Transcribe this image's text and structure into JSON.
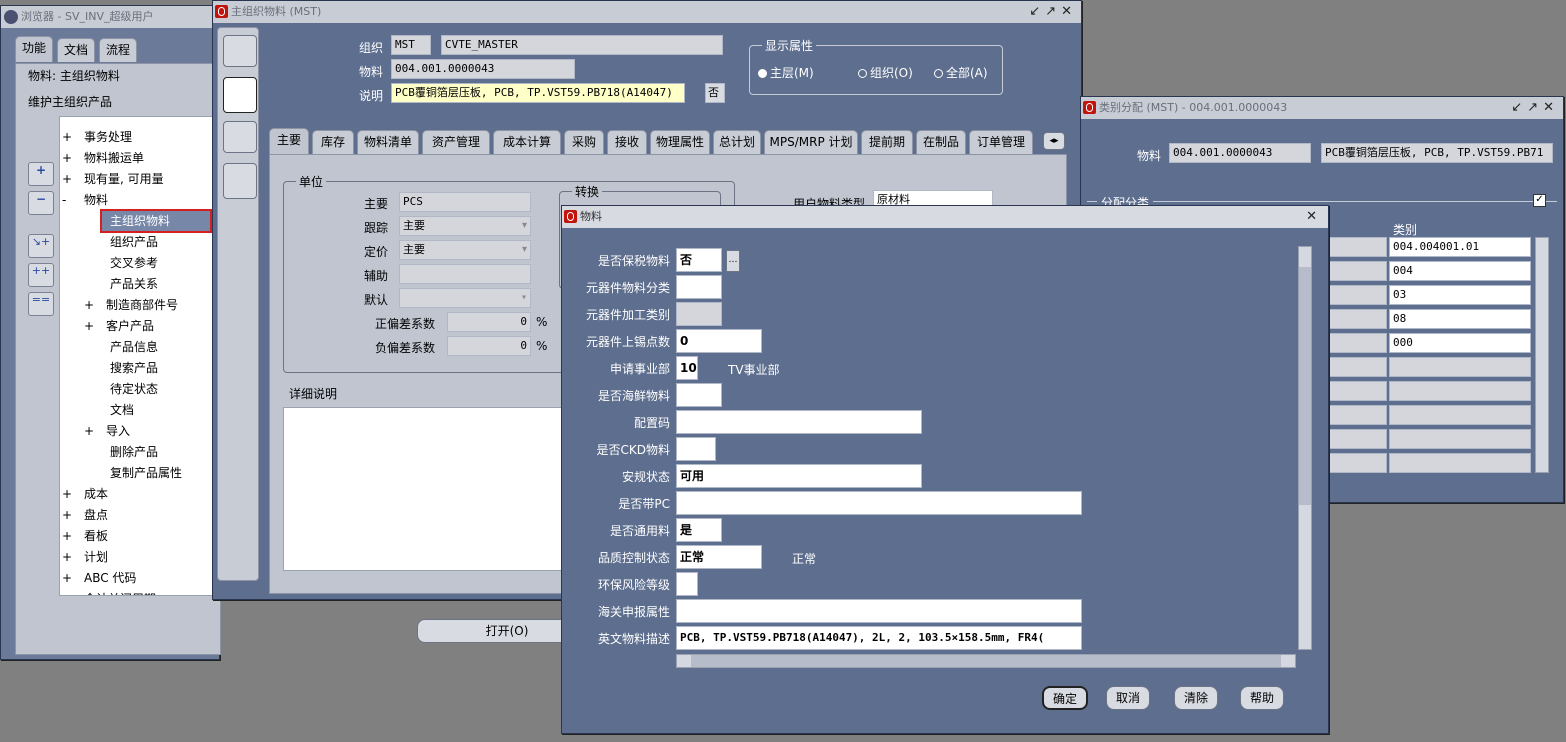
{
  "navigator": {
    "title": "浏览器 - SV_INV_超级用户",
    "tabs": [
      "功能",
      "文档",
      "流程"
    ],
    "context_line1": "物料: 主组织物料",
    "context_line2": "维护主组织产品",
    "tree": [
      {
        "pm": "+",
        "label": "事务处理",
        "indent": 0
      },
      {
        "pm": "+",
        "label": "物料搬运单",
        "indent": 0
      },
      {
        "pm": "+",
        "label": "现有量, 可用量",
        "indent": 0
      },
      {
        "pm": "-",
        "label": "物料",
        "indent": 0
      },
      {
        "pm": "",
        "label": "主组织物料",
        "indent": 2,
        "selected": true
      },
      {
        "pm": "",
        "label": "组织产品",
        "indent": 2
      },
      {
        "pm": "",
        "label": "交叉参考",
        "indent": 2
      },
      {
        "pm": "",
        "label": "产品关系",
        "indent": 2
      },
      {
        "pm": "+",
        "label": "制造商部件号",
        "indent": 1
      },
      {
        "pm": "+",
        "label": "客户产品",
        "indent": 1
      },
      {
        "pm": "",
        "label": "产品信息",
        "indent": 2
      },
      {
        "pm": "",
        "label": "搜索产品",
        "indent": 2
      },
      {
        "pm": "",
        "label": "待定状态",
        "indent": 2
      },
      {
        "pm": "",
        "label": "文档",
        "indent": 2
      },
      {
        "pm": "+",
        "label": "导入",
        "indent": 1
      },
      {
        "pm": "",
        "label": "删除产品",
        "indent": 2
      },
      {
        "pm": "",
        "label": "复制产品属性",
        "indent": 2
      },
      {
        "pm": "+",
        "label": "成本",
        "indent": 0
      },
      {
        "pm": "+",
        "label": "盘点",
        "indent": 0
      },
      {
        "pm": "+",
        "label": "看板",
        "indent": 0
      },
      {
        "pm": "+",
        "label": "计划",
        "indent": 0
      },
      {
        "pm": "+",
        "label": "ABC 代码",
        "indent": 0
      },
      {
        "pm": "+",
        "label": "会计关闭周期",
        "indent": 0
      }
    ],
    "open_button": "打开(O)"
  },
  "master_item": {
    "title": "主组织物料 (MST)",
    "org_label": "组织",
    "org_code": "MST",
    "org_name": "CVTE_MASTER",
    "item_label": "物料",
    "item_value": "004.001.0000043",
    "desc_label": "说明",
    "desc_value": "PCB覆铜箔层压板, PCB, TP.VST59.PB718(A14047)",
    "desc_flag": "否",
    "display_attr": {
      "legend": "显示属性",
      "options": [
        "主层(M)",
        "组织(O)",
        "全部(A)"
      ],
      "selected": 0
    },
    "tabs": [
      "主要",
      "库存",
      "物料清单",
      "资产管理",
      "成本计算",
      "采购",
      "接收",
      "物理属性",
      "总计划",
      "MPS/MRP 计划",
      "提前期",
      "在制品",
      "订单管理"
    ],
    "active_tab": 0,
    "unit_group": {
      "legend": "单位",
      "primary_label": "主要",
      "primary_value": "PCS",
      "tracking_label": "跟踪",
      "tracking_value": "主要",
      "pricing_label": "定价",
      "pricing_value": "主要",
      "secondary_label": "辅助",
      "secondary_value": "",
      "default_label": "默认",
      "default_value": "",
      "pos_dev_label": "正偏差系数",
      "pos_dev_value": "0",
      "neg_dev_label": "负偏差系数",
      "neg_dev_value": "0",
      "pct": "%"
    },
    "conversion_legend": "转换",
    "user_item_type_label": "用户物料类型",
    "user_item_type_value": "原材料",
    "detail_label": "详细说明"
  },
  "category": {
    "title": "类别分配 (MST) - 004.001.0000043",
    "item_label": "物料",
    "item_value": "004.001.0000043",
    "item_desc": "PCB覆铜箔层压板, PCB, TP.VST59.PB71",
    "assign_label": "分配分类",
    "col_header": "类别",
    "rows": [
      "004.004001.01",
      "004",
      "03",
      "08",
      "000",
      "",
      "",
      "",
      "",
      ""
    ]
  },
  "item_dialog": {
    "title": "物料",
    "rows": [
      {
        "label": "是否保税物料",
        "value": "否",
        "lov": true
      },
      {
        "label": "元器件物料分类",
        "value": ""
      },
      {
        "label": "元器件加工类别",
        "value": "",
        "ro": true
      },
      {
        "label": "元器件上锡点数",
        "value": "0"
      },
      {
        "label": "申请事业部",
        "value": "10",
        "extra": "TV事业部"
      },
      {
        "label": "是否海鲜物料",
        "value": ""
      },
      {
        "label": "配置码",
        "value": ""
      },
      {
        "label": "是否CKD物料",
        "value": ""
      },
      {
        "label": "安规状态",
        "value": "可用"
      },
      {
        "label": "是否带PC",
        "value": ""
      },
      {
        "label": "是否通用料",
        "value": "是"
      },
      {
        "label": "品质控制状态",
        "value": "正常",
        "extra": "正常"
      },
      {
        "label": "环保风险等级",
        "value": ""
      },
      {
        "label": "海关申报属性",
        "value": ""
      },
      {
        "label": "英文物料描述",
        "value": "PCB, TP.VST59.PB718(A14047), 2L, 2, 103.5×158.5mm, FR4("
      }
    ],
    "buttons": [
      "确定",
      "取消",
      "清除",
      "帮助"
    ]
  }
}
